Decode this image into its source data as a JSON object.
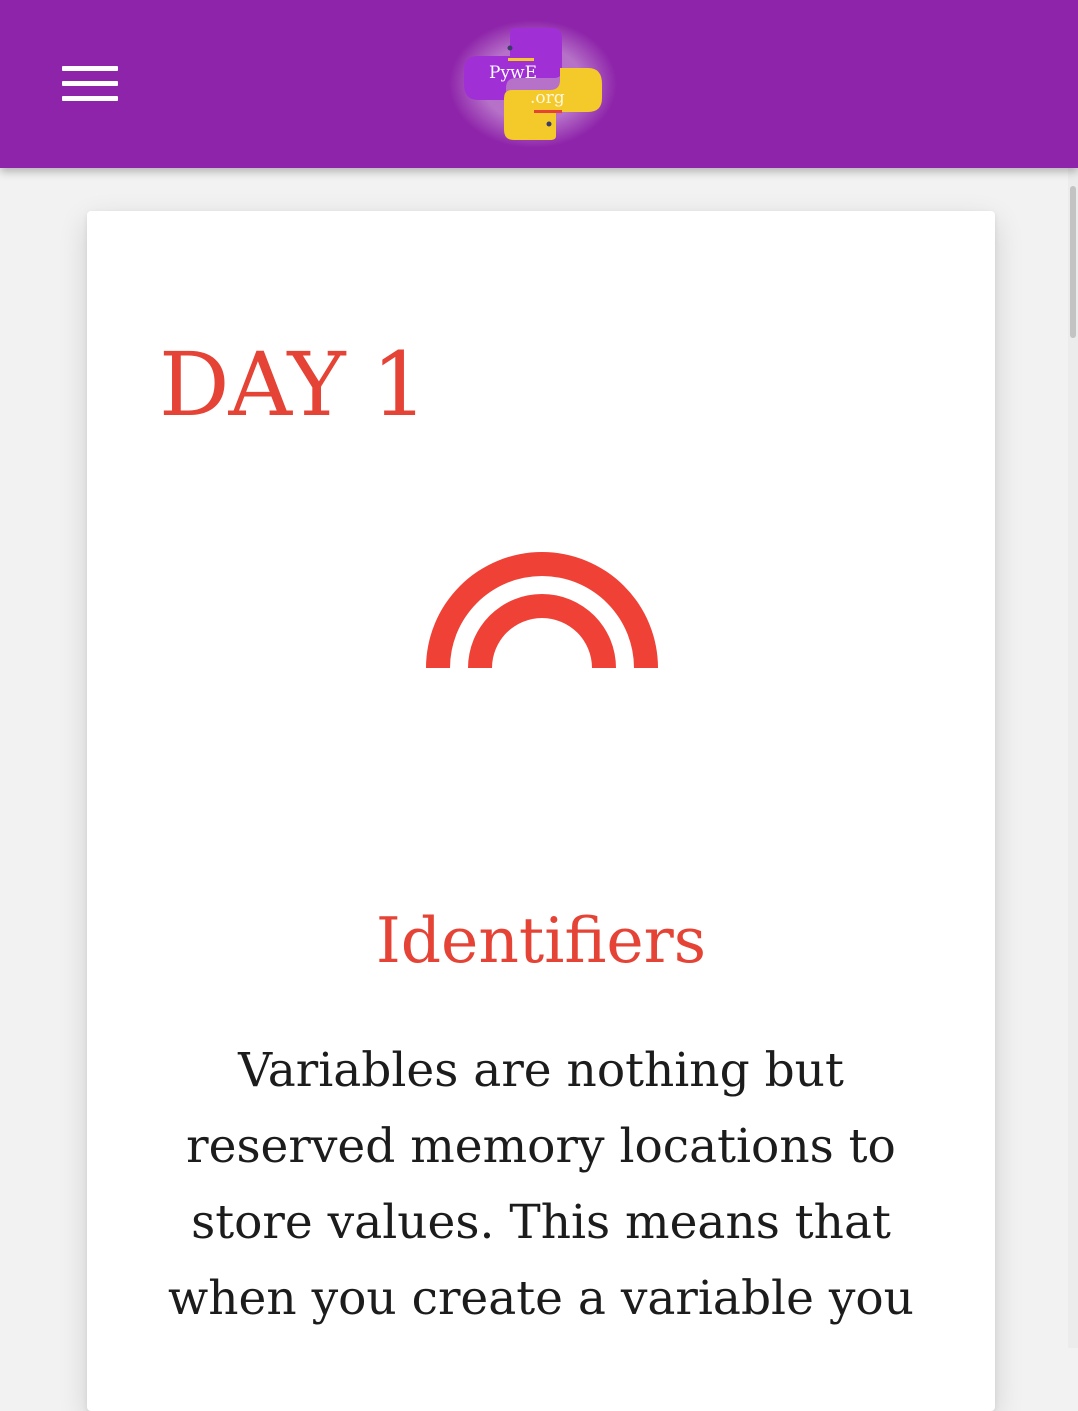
{
  "header": {
    "menu_icon": "hamburger-menu-icon",
    "logo": {
      "line1": "PywE",
      "line2": ".org",
      "colors": {
        "top": "#a02fd6",
        "bottom": "#f4c92a",
        "bar": "#8e24aa"
      }
    }
  },
  "card": {
    "day_title": "DAY 1",
    "icon": "arch-icon",
    "section_title": "Identifiers",
    "body": "Variables are nothing but reserved memory locations to store values. This means that when you create a variable you"
  },
  "colors": {
    "accent": "#e54335",
    "header_bg": "#8e24aa",
    "text": "#1c1c1c"
  }
}
